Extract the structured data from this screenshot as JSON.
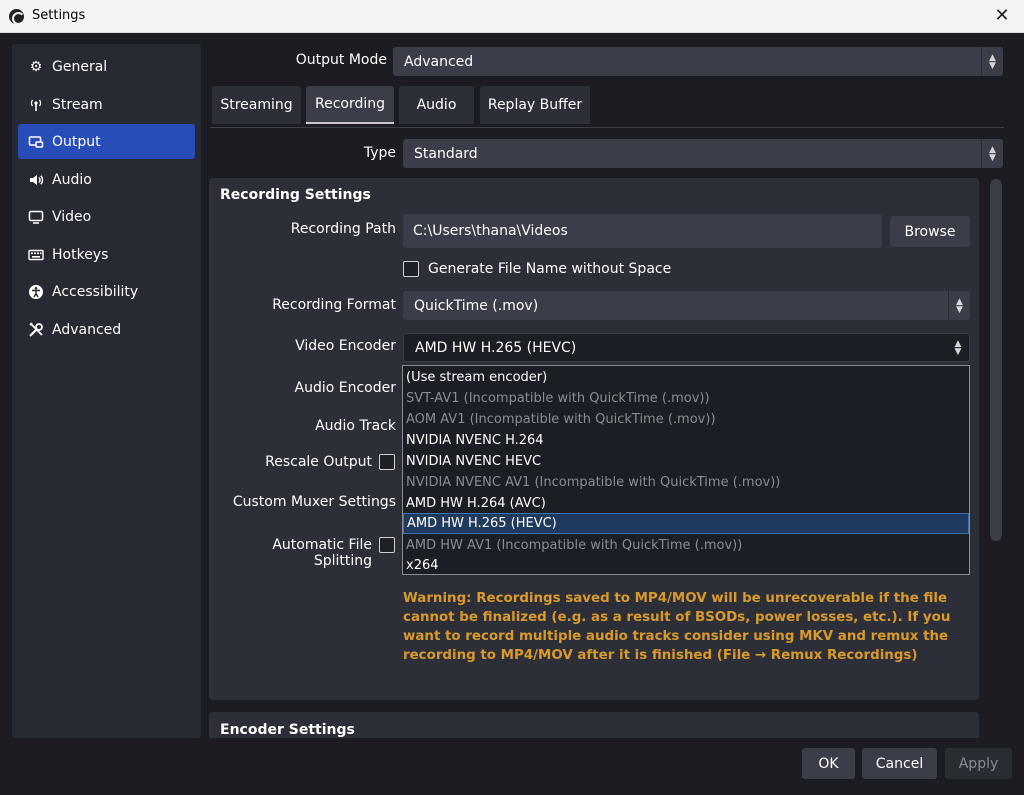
{
  "window": {
    "title": "Settings",
    "close_icon": "close-icon"
  },
  "sidebar": {
    "items": [
      {
        "label": "General",
        "icon": "gear-icon",
        "active": false
      },
      {
        "label": "Stream",
        "icon": "antenna-icon",
        "active": false
      },
      {
        "label": "Output",
        "icon": "output-icon",
        "active": true
      },
      {
        "label": "Audio",
        "icon": "speaker-icon",
        "active": false
      },
      {
        "label": "Video",
        "icon": "monitor-icon",
        "active": false
      },
      {
        "label": "Hotkeys",
        "icon": "keyboard-icon",
        "active": false
      },
      {
        "label": "Accessibility",
        "icon": "accessibility-icon",
        "active": false
      },
      {
        "label": "Advanced",
        "icon": "tools-icon",
        "active": false
      }
    ]
  },
  "output_mode": {
    "label": "Output Mode",
    "value": "Advanced"
  },
  "tabs": [
    {
      "label": "Streaming",
      "active": false
    },
    {
      "label": "Recording",
      "active": true
    },
    {
      "label": "Audio",
      "active": false
    },
    {
      "label": "Replay Buffer",
      "active": false
    }
  ],
  "type": {
    "label": "Type",
    "value": "Standard"
  },
  "recording_settings": {
    "title": "Recording Settings",
    "path_label": "Recording Path",
    "path_value": "C:\\Users\\thana\\Videos",
    "browse_label": "Browse",
    "gen_filename_label": "Generate File Name without Space",
    "format_label": "Recording Format",
    "format_value": "QuickTime (.mov)",
    "video_encoder_label": "Video Encoder",
    "video_encoder_value": "AMD HW H.265 (HEVC)",
    "audio_encoder_label": "Audio Encoder",
    "audio_track_label": "Audio Track",
    "rescale_label": "Rescale Output",
    "muxer_label": "Custom Muxer Settings",
    "splitting_label": "Automatic File Splitting",
    "warning": "Warning: Recordings saved to MP4/MOV will be unrecoverable if the file cannot be finalized (e.g. as a result of BSODs, power losses, etc.). If you want to record multiple audio tracks consider using MKV and remux the recording to MP4/MOV after it is finished (File → Remux Recordings)"
  },
  "encoder_options": [
    {
      "label": "(Use stream encoder)",
      "disabled": false,
      "selected": false
    },
    {
      "label": "SVT-AV1 (Incompatible with QuickTime (.mov))",
      "disabled": true,
      "selected": false
    },
    {
      "label": "AOM AV1 (Incompatible with QuickTime (.mov))",
      "disabled": true,
      "selected": false
    },
    {
      "label": "NVIDIA NVENC H.264",
      "disabled": false,
      "selected": false
    },
    {
      "label": "NVIDIA NVENC HEVC",
      "disabled": false,
      "selected": false
    },
    {
      "label": "NVIDIA NVENC AV1 (Incompatible with QuickTime (.mov))",
      "disabled": true,
      "selected": false
    },
    {
      "label": "AMD HW H.264 (AVC)",
      "disabled": false,
      "selected": false
    },
    {
      "label": "AMD HW H.265 (HEVC)",
      "disabled": false,
      "selected": true
    },
    {
      "label": "AMD HW AV1 (Incompatible with QuickTime (.mov))",
      "disabled": true,
      "selected": false
    },
    {
      "label": "x264",
      "disabled": false,
      "selected": false
    }
  ],
  "encoder_settings": {
    "title": "Encoder Settings"
  },
  "buttons": {
    "ok": "OK",
    "cancel": "Cancel",
    "apply": "Apply"
  },
  "colors": {
    "accent": "#284cb8",
    "warning": "#d99a2b",
    "background": "#1c1c22",
    "panel": "#2c2f38"
  }
}
